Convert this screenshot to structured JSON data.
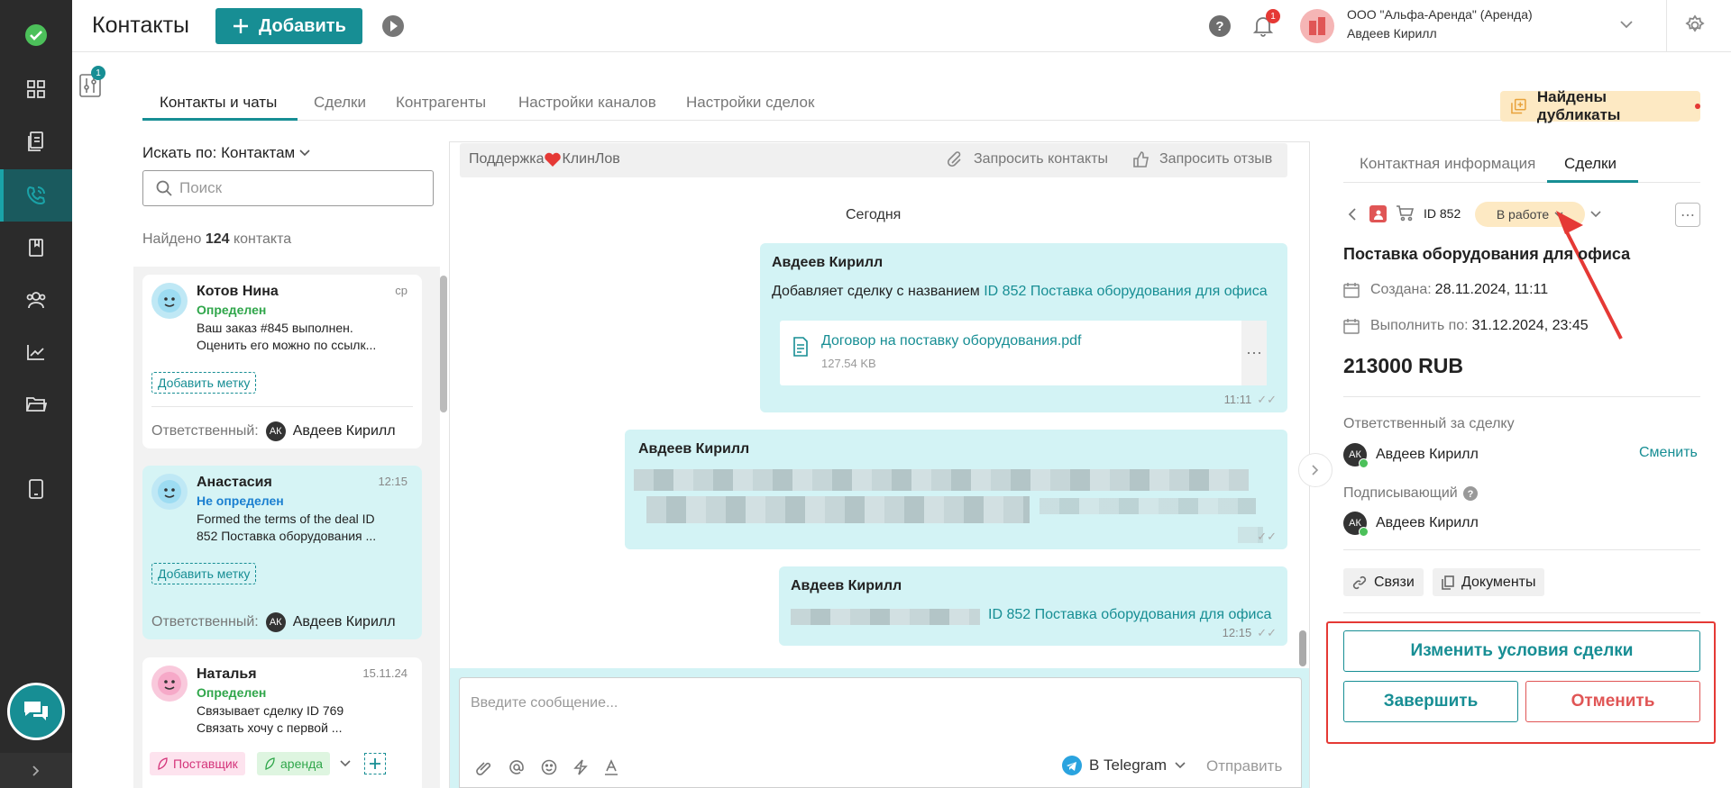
{
  "header": {
    "title": "Контакты",
    "add_label": "Добавить",
    "notif_count": "1",
    "org_name": "ООО \"Альфа-Аренда\" (Аренда)",
    "user_name": "Авдеев Кирилл"
  },
  "sidebar": {
    "badge": "1"
  },
  "tabs": [
    {
      "label": "Контакты и чаты"
    },
    {
      "label": "Сделки"
    },
    {
      "label": "Контрагенты"
    },
    {
      "label": "Настройки каналов"
    },
    {
      "label": "Настройки сделок"
    }
  ],
  "duplicates_label": "Найдены дубликаты",
  "contacts": {
    "search_by": "Искать по: Контактам",
    "search_placeholder": "Поиск",
    "found_prefix": "Найдено",
    "found_count": "124",
    "found_suffix": "контакта",
    "responsible_label": "Ответственный:",
    "add_tag_label": "Добавить метку",
    "items": [
      {
        "name": "Котов Нина",
        "status": "Определен",
        "time": "ср",
        "line1": "Ваш заказ #845 выполнен.",
        "line2": "Оценить его можно по ссылк...",
        "responsible": "Авдеев Кирилл",
        "initials": "АК"
      },
      {
        "name": "Анастасия",
        "status": "Не определен",
        "time": "12:15",
        "line1": "Formed the terms of the deal ID",
        "line2": "852 Поставка оборудования ...",
        "responsible": "Авдеев Кирилл",
        "initials": "АК"
      },
      {
        "name": "Наталья",
        "status": "Определен",
        "time": "15.11.24",
        "line1": "Связывает сделку ID 769",
        "line2": "Связать хочу с первой ...",
        "tags": [
          "Поставщик",
          "аренда"
        ]
      }
    ]
  },
  "chat": {
    "channel_prefix": "Поддержка",
    "channel_suffix": "КлинЛов",
    "request_contacts": "Запросить контакты",
    "request_review": "Запросить отзыв",
    "date_divider": "Сегодня",
    "messages": [
      {
        "author": "Авдеев Кирилл",
        "text": "Добавляет сделку с названием",
        "link": "ID 852 Поставка оборудования для офиса",
        "file_name": "Договор на поставку оборудования.pdf",
        "file_size": "127.54 KB",
        "time": "11:11"
      },
      {
        "author": "Авдеев Кирилл"
      },
      {
        "author": "Авдеев Кирилл",
        "link": "ID 852 Поставка оборудования для офиса",
        "time": "12:15"
      }
    ],
    "input_placeholder": "Введите сообщение...",
    "channel_select": "В Telegram",
    "send_label": "Отправить"
  },
  "deal": {
    "tabs": [
      {
        "label": "Контактная информация"
      },
      {
        "label": "Сделки"
      }
    ],
    "id": "ID 852",
    "status": "В работе",
    "title": "Поставка оборудования для офиса",
    "created_label": "Создана:",
    "created": "28.11.2024, 11:11",
    "due_label": "Выполнить по:",
    "due": "31.12.2024, 23:45",
    "amount": "213000 RUB",
    "responsible_label": "Ответственный за сделку",
    "responsible": "Авдеев Кирилл",
    "change_label": "Сменить",
    "signer_label": "Подписывающий",
    "signer": "Авдеев Кирилл",
    "initials": "АК",
    "links_label": "Связи",
    "docs_label": "Документы",
    "edit_terms": "Изменить условия сделки",
    "complete": "Завершить",
    "cancel": "Отменить"
  },
  "colors": {
    "accent": "#178e94",
    "cancel": "#e05555",
    "status_bg": "#fde9c3",
    "highlight": "#e53935"
  }
}
